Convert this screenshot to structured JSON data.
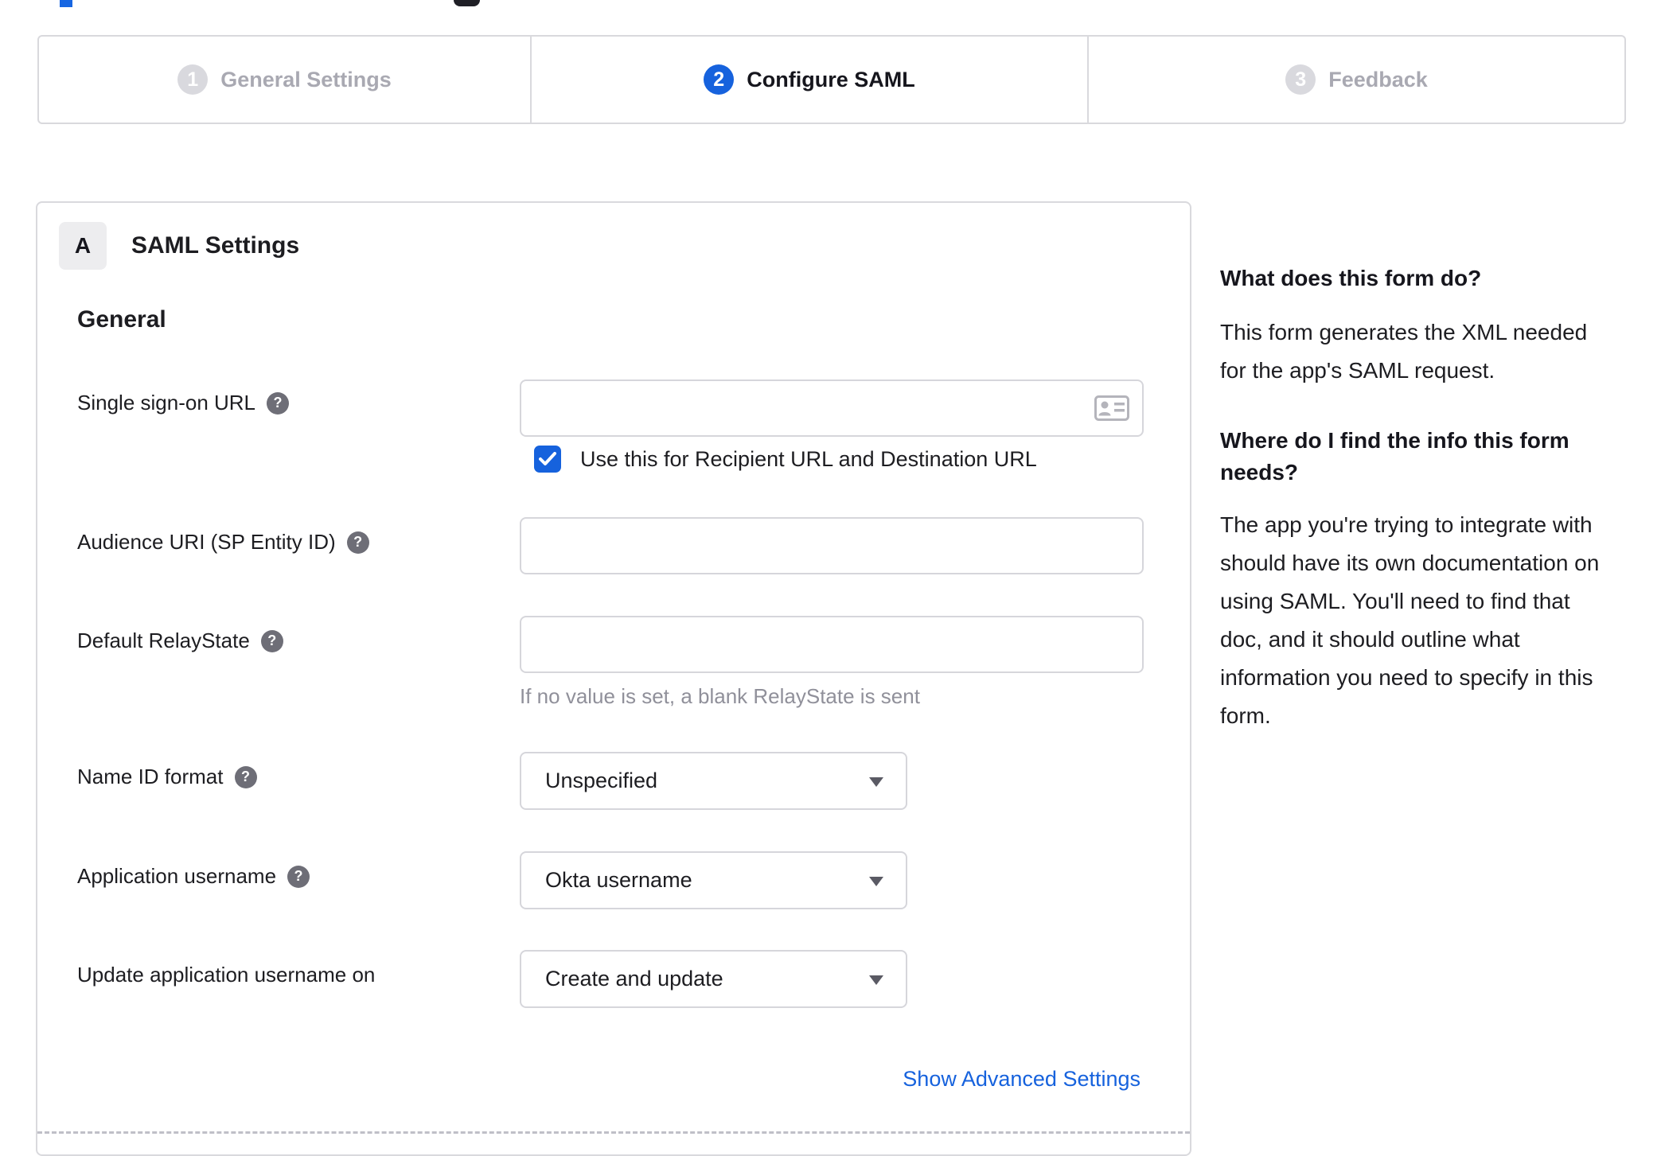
{
  "colors": {
    "accent_blue": "#1662dd",
    "inactive_gray": "#d9d9de",
    "border_gray": "#d9d9dd"
  },
  "stepper": {
    "steps": [
      {
        "number": "1",
        "label": "General Settings",
        "state": "inactive"
      },
      {
        "number": "2",
        "label": "Configure SAML",
        "state": "active"
      },
      {
        "number": "3",
        "label": "Feedback",
        "state": "inactive"
      }
    ]
  },
  "panel": {
    "badge": "A",
    "title": "SAML Settings",
    "section_heading": "General"
  },
  "fields": {
    "sso": {
      "label": "Single sign-on URL",
      "value": "",
      "checkbox_label": "Use this for Recipient URL and Destination URL",
      "checkbox_checked": true
    },
    "audience": {
      "label": "Audience URI (SP Entity ID)",
      "value": ""
    },
    "relay": {
      "label": "Default RelayState",
      "value": "",
      "hint": "If no value is set, a blank RelayState is sent"
    },
    "name_id": {
      "label": "Name ID format",
      "value": "Unspecified"
    },
    "app_username": {
      "label": "Application username",
      "value": "Okta username"
    },
    "update_username": {
      "label": "Update application username on",
      "value": "Create and update"
    }
  },
  "advanced_link": "Show Advanced Settings",
  "sidebar": {
    "q1": "What does this form do?",
    "a1": "This form generates the XML needed\nfor the app's SAML request.",
    "q2": "Where do I find the info this form\nneeds?",
    "a2": "The app you're trying to integrate with\nshould have its own documentation on\nusing SAML. You'll need to find that\ndoc, and it should outline what\ninformation you need to specify in this\nform."
  }
}
